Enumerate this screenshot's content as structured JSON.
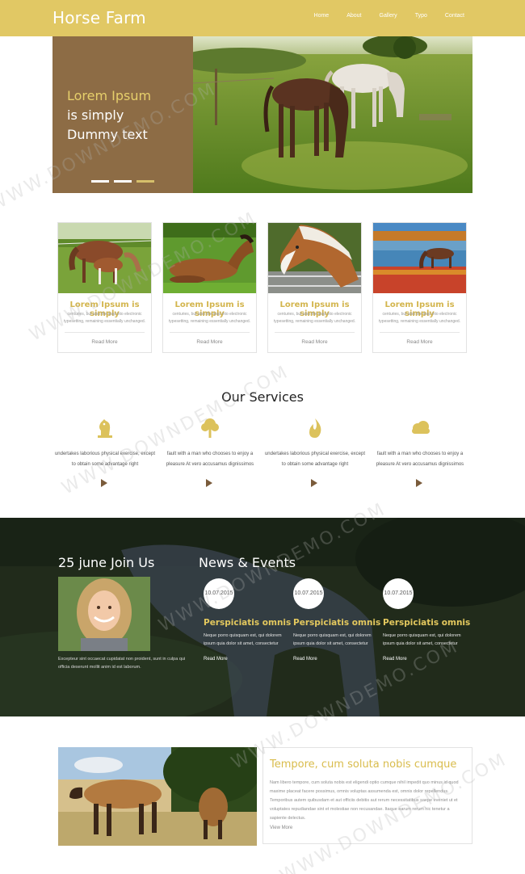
{
  "header": {
    "logo": "Horse Farm",
    "nav": [
      "Home",
      "About",
      "Gallery",
      "Typo",
      "Contact"
    ]
  },
  "hero": {
    "line1": "Lorem Ipsum",
    "line2": "is simply",
    "line3": "Dummy text",
    "slides": 3,
    "active_slide": 3
  },
  "cards": [
    {
      "title": "Lorem Ipsum is simply",
      "desc": "centuries, but also the leap into electronic typesetting, remaining essentially unchanged.",
      "more": "Read More"
    },
    {
      "title": "Lorem Ipsum is simply",
      "desc": "centuries, but also the leap into electronic typesetting, remaining essentially unchanged.",
      "more": "Read More"
    },
    {
      "title": "Lorem Ipsum is simply",
      "desc": "centuries, but also the leap into electronic typesetting, remaining essentially unchanged.",
      "more": "Read More"
    },
    {
      "title": "Lorem Ipsum is simply",
      "desc": "centuries, but also the leap into electronic typesetting, remaining essentially unchanged.",
      "more": "Read More"
    }
  ],
  "services": {
    "title": "Our Services",
    "items": [
      {
        "icon": "chess-knight-icon",
        "text": "undertakes laborious physical exercise, except to obtain some advantage right"
      },
      {
        "icon": "tree-icon",
        "text": "fault with a man who chooses to enjoy a pleasure At vero accusamus dignissimos"
      },
      {
        "icon": "flame-icon",
        "text": "undertakes laborious physical exercise, except to obtain some advantage right"
      },
      {
        "icon": "cloud-icon",
        "text": "fault with a man who chooses to enjoy a pleasure At vero accusamus dignissimos"
      }
    ]
  },
  "join": {
    "title": "25 june Join Us",
    "text": "Excepteur sint occaecat cupidatat non proident, sunt in culpa qui officia deserunt mollit anim id est laborum."
  },
  "news": {
    "title": "News & Events",
    "events": [
      {
        "date": "10.07.2015",
        "title": "Perspiciatis omnis",
        "text": "Neque porro quisquam est, qui dolorem ipsum quia dolor sit amet, consectetur",
        "more": "Read More"
      },
      {
        "date": "10.07.2015",
        "title": "Perspiciatis omnis",
        "text": "Neque porro quisquam est, qui dolorem ipsum quia dolor sit amet, consectetur",
        "more": "Read More"
      },
      {
        "date": "10.07.2015",
        "title": "Perspiciatis omnis",
        "text": "Neque porro quisquam est, qui dolorem ipsum quia dolor sit amet, consectetur",
        "more": "Read More"
      }
    ]
  },
  "bottom": {
    "title": "Tempore, cum soluta nobis cumque",
    "text": "Nam libero tempore, cum soluta nobis est eligendi optio cumque nihil impedit quo minus id quod maxime placeat facere possimus, omnis voluptas assumenda est, omnis dolor repellendus. Temporibus autem quibusdam et aut officiis debitis aut rerum necessitatibus saepe eveniet ut et voluptates repudiandae sint et molestiae non recusandae. Itaque earum rerum hic tenetur a sapiente delectus.",
    "more": "View More"
  },
  "watermark": "WWW.DOWNDEMO.COM",
  "colors": {
    "header": "#e1c864",
    "hero_panel": "#8d6c45",
    "accent": "#d3b54d",
    "arrow": "#7a5b3b"
  }
}
